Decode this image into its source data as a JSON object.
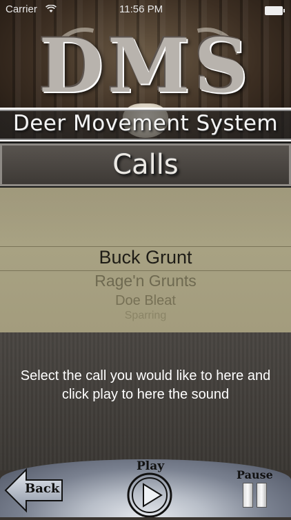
{
  "status_bar": {
    "carrier": "Carrier",
    "time": "11:56 PM"
  },
  "header": {
    "logo": "DMS",
    "subtitle": "Deer Movement System"
  },
  "section": {
    "title": "Calls"
  },
  "picker": {
    "selected": "Buck Grunt",
    "items": [
      "Rage'n Grunts",
      "Doe Bleat",
      "Sparring"
    ]
  },
  "info": {
    "instructions": "Select the call you would like to here and click play to here the sound"
  },
  "controls": {
    "back_label": "Back",
    "play_label": "Play",
    "pause_label": "Pause"
  }
}
